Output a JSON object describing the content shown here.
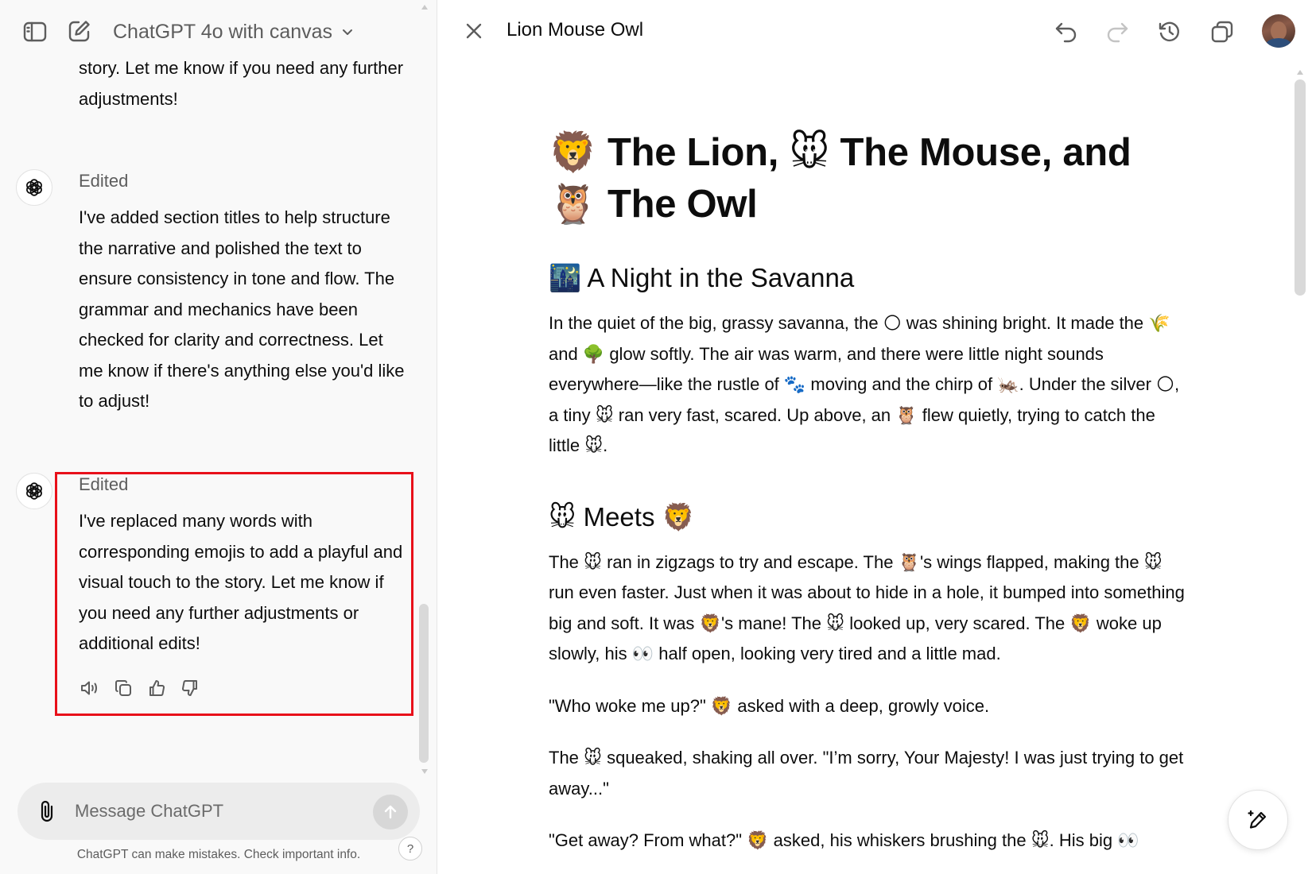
{
  "header": {
    "model_label": "ChatGPT 4o with canvas"
  },
  "chat": {
    "previous_tail": "story. Let me know if you need any further adjustments!",
    "messages": [
      {
        "status": "Edited",
        "text": "I've added section titles to help structure the narrative and polished the text to ensure consistency in tone and flow. The grammar and mechanics have been checked for clarity and correctness. Let me know if there's anything else you'd like to adjust!"
      },
      {
        "status": "Edited",
        "text": "I've replaced many words with corresponding emojis to add a playful and visual touch to the story. Let me know if you need any further adjustments or additional edits!"
      }
    ],
    "highlight_color": "#e8101a"
  },
  "composer": {
    "placeholder": "Message ChatGPT",
    "disclaimer": "ChatGPT can make mistakes. Check important info.",
    "help_label": "?"
  },
  "canvas": {
    "title": "Lion Mouse Owl",
    "doc_title": "🦁 The Lion, 🐭 The Mouse, and 🦉 The Owl",
    "sections": [
      {
        "heading": "🌃 A Night in the Savanna",
        "paragraphs": [
          "In the quiet of the big, grassy savanna, the 🌕 was shining bright. It made the 🌾 and 🌳 glow softly. The air was warm, and there were little night sounds everywhere—like the rustle of 🐾 moving and the chirp of 🦗. Under the silver 🌕, a tiny 🐭 ran very fast, scared. Up above, an 🦉 flew quietly, trying to catch the little 🐭."
        ]
      },
      {
        "heading": "🐭 Meets 🦁",
        "paragraphs": [
          "The 🐭 ran in zigzags to try and escape. The 🦉's wings flapped, making the 🐭 run even faster. Just when it was about to hide in a hole, it bumped into something big and soft. It was 🦁's mane! The 🐭 looked up, very scared. The 🦁 woke up slowly, his 👀 half open, looking very tired and a little mad.",
          "\"Who woke me up?\" 🦁 asked with a deep, growly voice.",
          "The 🐭 squeaked, shaking all over. \"I’m sorry, Your Majesty! I was just trying to get away...\"",
          "\"Get away? From what?\" 🦁 asked, his whiskers brushing the 🐭. His big 👀"
        ]
      }
    ]
  }
}
